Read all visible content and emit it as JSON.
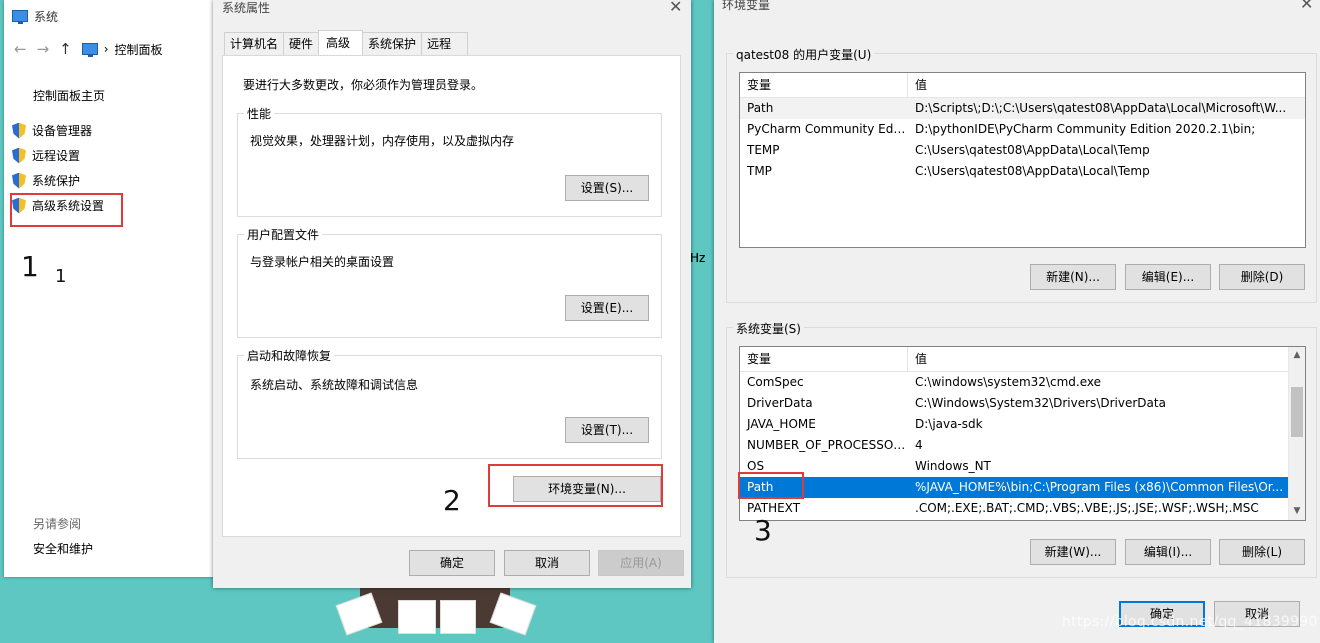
{
  "system_window": {
    "title": "系统",
    "breadcrumb": "控制面板",
    "nav_back": "←",
    "nav_forward": "→",
    "nav_up": "↑",
    "crumb_sep": "›",
    "home_link": "控制面板主页",
    "links": [
      "设备管理器",
      "远程设置",
      "系统保护",
      "高级系统设置"
    ],
    "see_also": "另请参阅",
    "security": "安全和维护",
    "clipped_text": "Hz"
  },
  "props_dialog": {
    "title": "系统属性",
    "tabs": [
      "计算机名",
      "硬件",
      "高级",
      "系统保护",
      "远程"
    ],
    "active_tab": "高级",
    "admin_note": "要进行大多数更改，你必须作为管理员登录。",
    "groups": [
      {
        "label": "性能",
        "desc": "视觉效果，处理器计划，内存使用，以及虚拟内存",
        "button": "设置(S)..."
      },
      {
        "label": "用户配置文件",
        "desc": "与登录帐户相关的桌面设置",
        "button": "设置(E)..."
      },
      {
        "label": "启动和故障恢复",
        "desc": "系统启动、系统故障和调试信息",
        "button": "设置(T)..."
      }
    ],
    "env_button": "环境变量(N)...",
    "ok": "确定",
    "cancel": "取消",
    "apply": "应用(A)"
  },
  "env_dialog": {
    "title": "环境变量",
    "user_section": "qatest08 的用户变量(U)",
    "col_var": "变量",
    "col_val": "值",
    "user_vars": [
      {
        "name": "Path",
        "value": "D:\\Scripts\\;D:\\;C:\\Users\\qatest08\\AppData\\Local\\Microsoft\\W..."
      },
      {
        "name": "PyCharm Community Editi...",
        "value": "D:\\pythonIDE\\PyCharm Community Edition 2020.2.1\\bin;"
      },
      {
        "name": "TEMP",
        "value": "C:\\Users\\qatest08\\AppData\\Local\\Temp"
      },
      {
        "name": "TMP",
        "value": "C:\\Users\\qatest08\\AppData\\Local\\Temp"
      }
    ],
    "user_buttons": [
      "新建(N)...",
      "编辑(E)...",
      "删除(D)"
    ],
    "sys_section": "系统变量(S)",
    "sys_vars": [
      {
        "name": "ComSpec",
        "value": "C:\\windows\\system32\\cmd.exe"
      },
      {
        "name": "DriverData",
        "value": "C:\\Windows\\System32\\Drivers\\DriverData"
      },
      {
        "name": "JAVA_HOME",
        "value": "D:\\java-sdk"
      },
      {
        "name": "NUMBER_OF_PROCESSORS",
        "value": "4"
      },
      {
        "name": "OS",
        "value": "Windows_NT"
      },
      {
        "name": "Path",
        "value": "%JAVA_HOME%\\bin;C:\\Program Files (x86)\\Common Files\\Or..."
      },
      {
        "name": "PATHEXT",
        "value": ".COM;.EXE;.BAT;.CMD;.VBS;.VBE;.JS;.JSE;.WSF;.WSH;.MSC"
      }
    ],
    "selected_sys_index": 5,
    "sys_buttons": [
      "新建(W)...",
      "编辑(I)...",
      "删除(L)"
    ],
    "ok": "确定",
    "cancel": "取消"
  },
  "annotations": {
    "step1": "1",
    "step1_small": "1",
    "step2": "2",
    "step3": "3"
  },
  "watermark": "https://blog.csdn.net/qq_41839990",
  "colors": {
    "desktop": "#5ec7c2",
    "selection": "#0078d7",
    "annotation": "#e03b3b"
  }
}
